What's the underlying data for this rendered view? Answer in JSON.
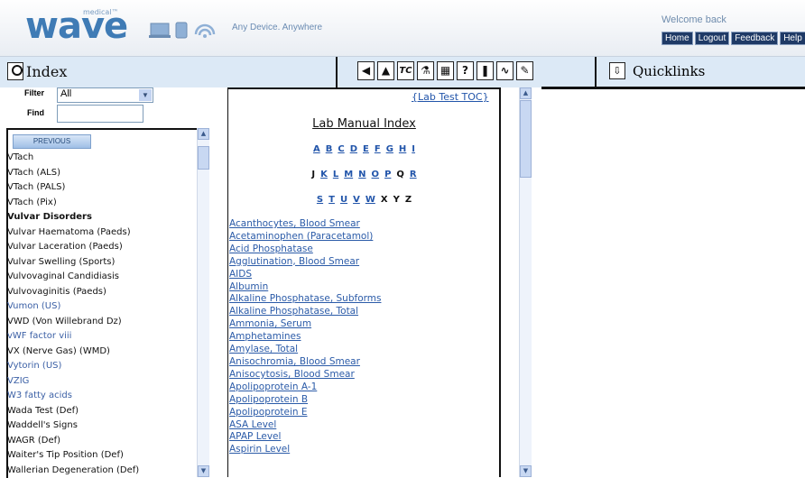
{
  "brand": {
    "logo": "wave",
    "logo_super": "medical™",
    "tagline": "Any Device. Anywhere"
  },
  "user": {
    "welcome": "Welcome back"
  },
  "top_links": [
    "Home",
    "Logout",
    "Feedback",
    "Help"
  ],
  "toolbar": {
    "index_label": "Index",
    "quicklinks_label": "Quicklinks",
    "tools": [
      "back-arrow-icon",
      "up-arrow-icon",
      "tc-icon",
      "lab-flask-icon",
      "calculator-icon",
      "help-icon",
      "drug-icon",
      "ecg-icon",
      "pencil-icon"
    ],
    "tool_glyphs": [
      "◀",
      "▲",
      "TC",
      "⚗",
      "▦",
      "?",
      "❚",
      "∿",
      "✎"
    ]
  },
  "filter": {
    "label": "Filter",
    "value": "All",
    "find_label": "Find",
    "find_value": ""
  },
  "prev_button": "PREVIOUS",
  "index_items": [
    {
      "text": "VTach",
      "style": ""
    },
    {
      "text": "VTach (ALS)",
      "style": ""
    },
    {
      "text": "VTach (PALS)",
      "style": ""
    },
    {
      "text": "VTach (Pix)",
      "style": ""
    },
    {
      "text": "Vulvar Disorders",
      "style": "bold"
    },
    {
      "text": "Vulvar Haematoma (Paeds)",
      "style": ""
    },
    {
      "text": "Vulvar Laceration (Paeds)",
      "style": ""
    },
    {
      "text": "Vulvar Swelling (Sports)",
      "style": ""
    },
    {
      "text": "Vulvovaginal Candidiasis",
      "style": ""
    },
    {
      "text": "Vulvovaginitis (Paeds)",
      "style": ""
    },
    {
      "text": "Vumon (US)",
      "style": "blue"
    },
    {
      "text": "VWD (Von Willebrand Dz)",
      "style": ""
    },
    {
      "text": "vWF factor viii",
      "style": "blue"
    },
    {
      "text": "VX (Nerve Gas) (WMD)",
      "style": ""
    },
    {
      "text": "Vytorin (US)",
      "style": "blue"
    },
    {
      "text": "VZIG",
      "style": "blue"
    },
    {
      "text": "W3 fatty acids",
      "style": "blue"
    },
    {
      "text": "Wada Test (Def)",
      "style": ""
    },
    {
      "text": "Waddell's Signs",
      "style": ""
    },
    {
      "text": "WAGR (Def)",
      "style": ""
    },
    {
      "text": "Waiter's Tip Position (Def)",
      "style": ""
    },
    {
      "text": "Wallerian Degeneration (Def)",
      "style": ""
    }
  ],
  "lab": {
    "toc_link": "{Lab Test TOC}",
    "title": "Lab Manual Index",
    "alpha_rows": [
      [
        {
          "l": "A",
          "link": true
        },
        {
          "l": "B",
          "link": true
        },
        {
          "l": "C",
          "link": true
        },
        {
          "l": "D",
          "link": true
        },
        {
          "l": "E",
          "link": true
        },
        {
          "l": "F",
          "link": true
        },
        {
          "l": "G",
          "link": true
        },
        {
          "l": "H",
          "link": true
        },
        {
          "l": "I",
          "link": true
        }
      ],
      [
        {
          "l": "J",
          "link": false
        },
        {
          "l": "K",
          "link": true
        },
        {
          "l": "L",
          "link": true
        },
        {
          "l": "M",
          "link": true
        },
        {
          "l": "N",
          "link": true
        },
        {
          "l": "O",
          "link": true
        },
        {
          "l": "P",
          "link": true
        },
        {
          "l": "Q",
          "link": false
        },
        {
          "l": "R",
          "link": true
        }
      ],
      [
        {
          "l": "S",
          "link": true
        },
        {
          "l": "T",
          "link": true
        },
        {
          "l": "U",
          "link": true
        },
        {
          "l": "V",
          "link": true
        },
        {
          "l": "W",
          "link": true
        },
        {
          "l": "X",
          "link": false
        },
        {
          "l": "Y",
          "link": false
        },
        {
          "l": "Z",
          "link": false
        }
      ]
    ],
    "tests": [
      "Acanthocytes, Blood Smear",
      "Acetaminophen (Paracetamol)",
      "Acid Phosphatase",
      "Agglutination, Blood Smear",
      "AIDS",
      "Albumin",
      "Alkaline Phosphatase, Subforms",
      "Alkaline Phosphatase, Total",
      "Ammonia, Serum",
      "Amphetamines",
      "Amylase, Total",
      "Anisochromia, Blood Smear",
      "Anisocytosis, Blood Smear",
      "Apolipoprotein A-1",
      "Apolipoprotein B",
      "Apolipoprotein E",
      "ASA Level",
      "APAP Level",
      "Aspirin Level"
    ]
  }
}
